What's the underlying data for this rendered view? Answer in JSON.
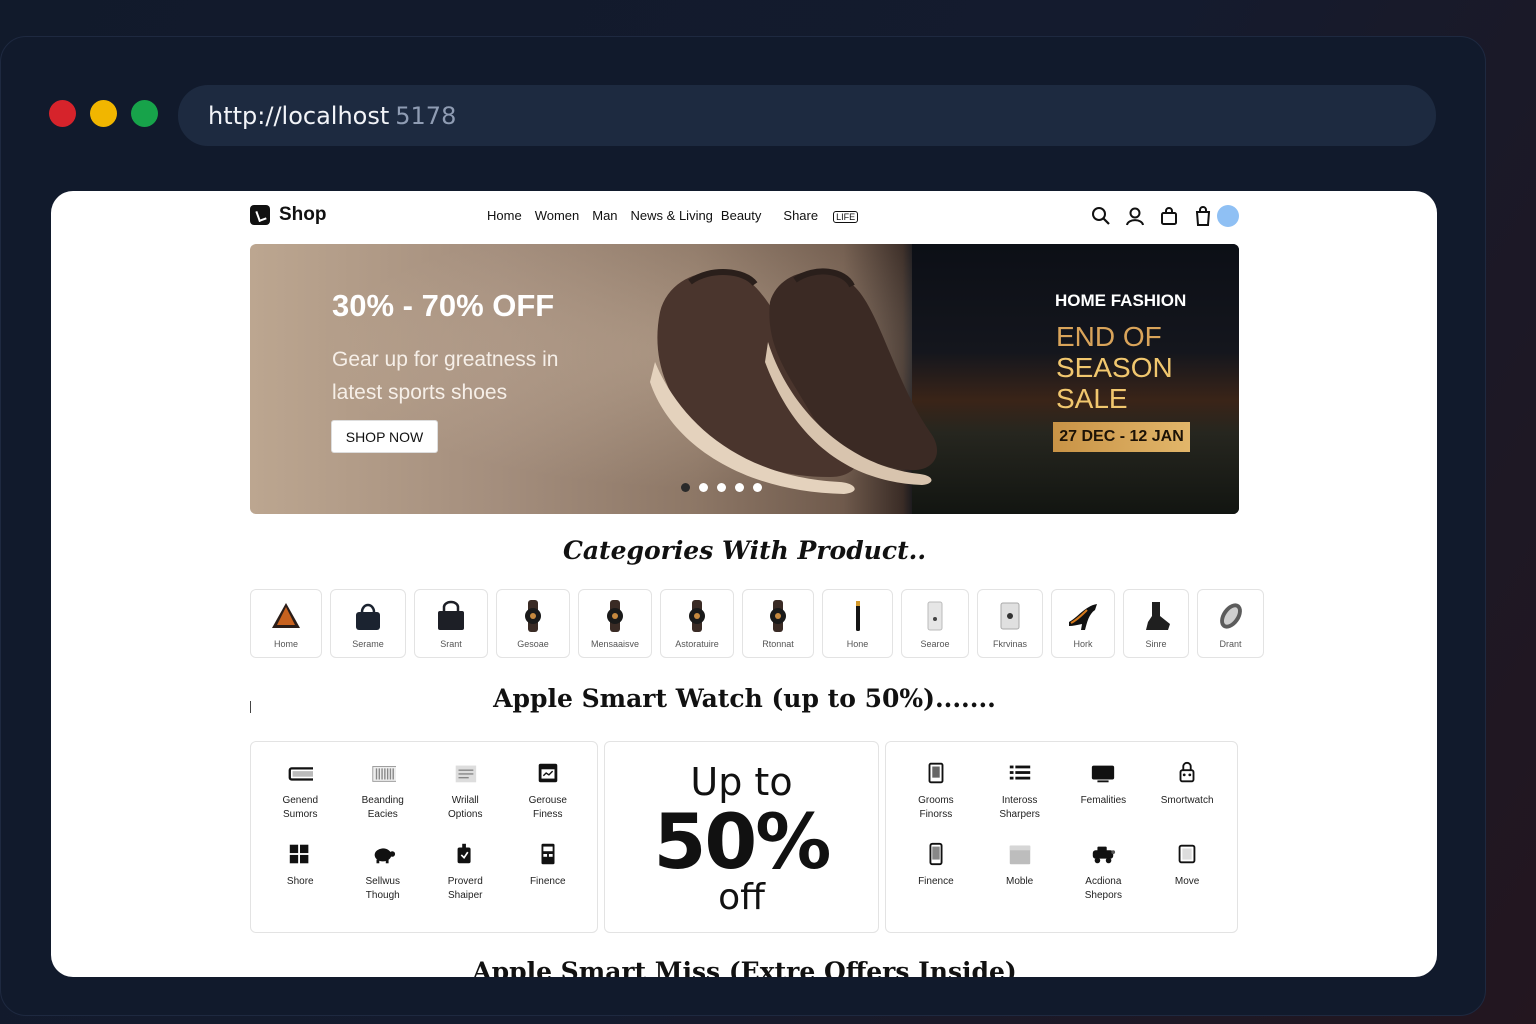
{
  "browser": {
    "url_main": "http://localhost",
    "url_port": "5178",
    "colors": {
      "close": "#d6232b",
      "minimize": "#f1b600",
      "maximize": "#17a34a"
    }
  },
  "header": {
    "brand": "Shop",
    "menu": [
      "Home",
      "Women",
      "Man",
      "News & Living",
      "Beauty",
      "Share"
    ],
    "share_badge": "LIFE",
    "icons": [
      "search-icon",
      "user-icon",
      "bag-icon",
      "cart-icon"
    ]
  },
  "hero": {
    "title": "30% - 70% OFF",
    "subtitle": "Gear up for greatness in latest sports shoes",
    "cta": "SHOP NOW",
    "slides": 5,
    "active_slide": 1,
    "sale_kicker": "HOME FASHION",
    "sale_head": [
      "END OF",
      "SEASON",
      "SALE"
    ],
    "sale_dates": "27 DEC - 12 JAN"
  },
  "categories": {
    "title": "Categories  With Product..",
    "items": [
      {
        "label": "Home",
        "icon": "pyramid-icon"
      },
      {
        "label": "Serame",
        "icon": "handbag-icon"
      },
      {
        "label": "Srant",
        "icon": "tote-bag-icon"
      },
      {
        "label": "Gesoae",
        "icon": "watch-icon"
      },
      {
        "label": "Mensaaisve",
        "icon": "watch-icon"
      },
      {
        "label": "Astoratuire",
        "icon": "watch-icon"
      },
      {
        "label": "Rtonnat",
        "icon": "watch-icon"
      },
      {
        "label": "Hone",
        "icon": "stick-icon"
      },
      {
        "label": "Searoe",
        "icon": "speaker-icon"
      },
      {
        "label": "Fkrvinas",
        "icon": "device-icon"
      },
      {
        "label": "Hork",
        "icon": "heel-shoe-icon"
      },
      {
        "label": "Sinre",
        "icon": "boot-icon"
      },
      {
        "label": "Drant",
        "icon": "band-icon"
      }
    ]
  },
  "watch_section": {
    "title": "Apple Smart Watch (up to 50%).......",
    "left_items": [
      {
        "label": "Genend\nSumors",
        "icon": "battery-icon"
      },
      {
        "label": "Beanding\nEacies",
        "icon": "barcode-icon"
      },
      {
        "label": "Wrilall\nOptions",
        "icon": "document-icon"
      },
      {
        "label": "Gerouse\nFiness",
        "icon": "screen-icon"
      },
      {
        "label": "Shore",
        "icon": "grid-icon"
      },
      {
        "label": "Sellwus\nThough",
        "icon": "turtle-icon"
      },
      {
        "label": "Proverd\nShaiper",
        "icon": "timer-icon"
      },
      {
        "label": "Finence",
        "icon": "calculator-icon"
      }
    ],
    "promo": {
      "line1": "Up to",
      "line2": "50%",
      "line3": "off"
    },
    "right_items": [
      {
        "label": "Grooms\nFinorss",
        "icon": "tablet-icon"
      },
      {
        "label": "Inteross\nSharpers",
        "icon": "list-icon"
      },
      {
        "label": "Femalities",
        "icon": "monitor-icon"
      },
      {
        "label": "Smortwatch",
        "icon": "robot-icon"
      },
      {
        "label": "Finence",
        "icon": "phone-icon"
      },
      {
        "label": "Moble",
        "icon": "folder-icon"
      },
      {
        "label": "Acdiona\nShepors",
        "icon": "vehicle-icon"
      },
      {
        "label": "Move",
        "icon": "square-device-icon"
      }
    ]
  },
  "next_section": {
    "title": "Apple Smart Miss (Extre Offers Inside)"
  }
}
